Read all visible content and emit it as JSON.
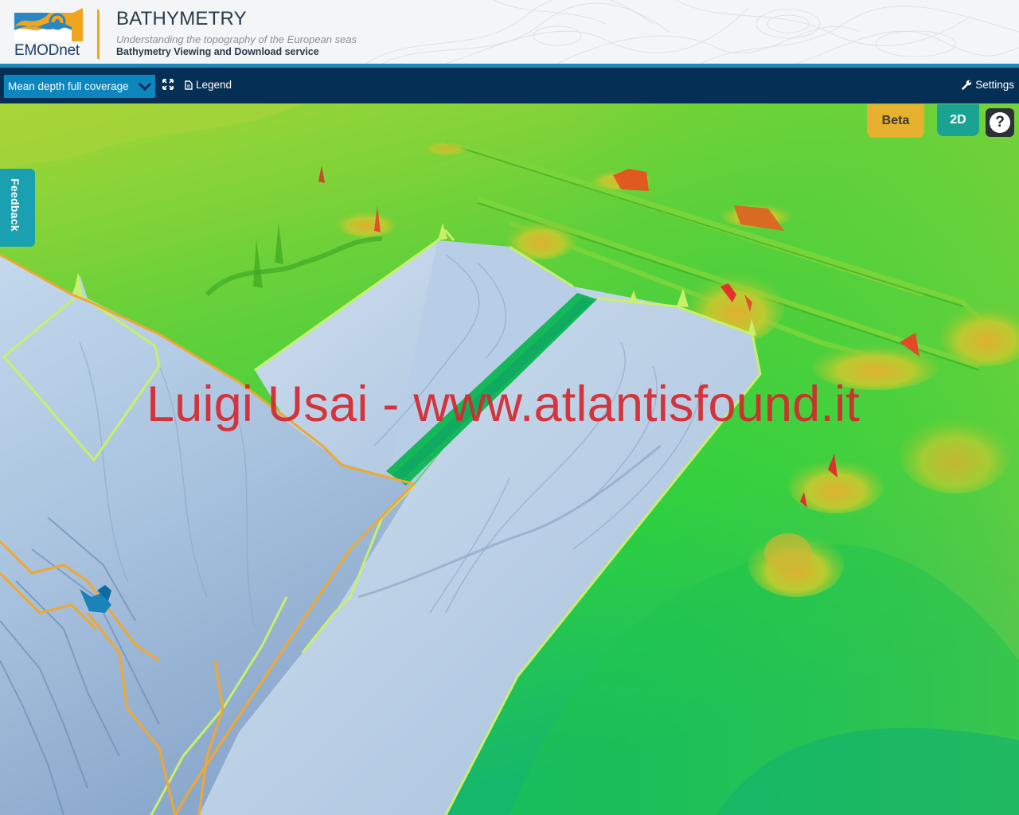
{
  "header": {
    "brand": "EMODnet",
    "title": "BATHYMETRY",
    "subtitle": "Understanding the topography of the European seas",
    "service": "Bathymetry Viewing and Download service"
  },
  "toolbar": {
    "layer_selected": "Mean depth full coverage",
    "legend_label": "Legend",
    "settings_label": "Settings"
  },
  "map": {
    "feedback_label": "Feedback",
    "beta_label": "Beta",
    "view_mode_label": "2D",
    "help_label": "?",
    "watermark": "Luigi Usai - www.atlantisfound.it"
  },
  "colors": {
    "header_bg": "#f4f5f6",
    "toolbar_bg": "#062f55",
    "select_bg": "#0d86bd",
    "beta_bg": "#e7b02f",
    "twod_bg": "#1aa393",
    "feedback_bg": "#1aa0b0",
    "watermark": "#d6262e"
  }
}
